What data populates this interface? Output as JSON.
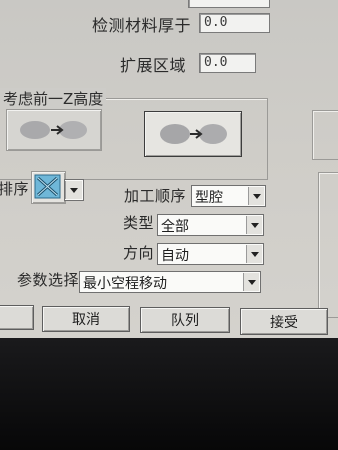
{
  "dialog": {
    "check_thickness_label": "检测材料厚于",
    "check_thickness_value": "0.0",
    "extend_area_label": "扩展区域",
    "extend_area_value": "0.0",
    "consider_prev_group_label": "考虑前一Z高度",
    "order_label_fragment": "排序",
    "machining_order_label": "加工顺序",
    "machining_order_value": "型腔",
    "type_label": "类型",
    "type_value": "全部",
    "direction_label": "方向",
    "direction_value": "自动",
    "param_select_label": "参数选择",
    "param_select_value": "最小空程移动"
  },
  "buttons": {
    "cancel": "取消",
    "queue": "队列",
    "accept": "接受"
  },
  "colors": {
    "dialog_bg": "#cdccc8",
    "bezel": "#0b0b0d",
    "field_bg": "#f2f2f0"
  },
  "icons": {
    "order_icon": "order-pattern-icon",
    "mode_a_icon": "surface-arrow-icon",
    "mode_b_icon": "surface-arrow-icon"
  }
}
